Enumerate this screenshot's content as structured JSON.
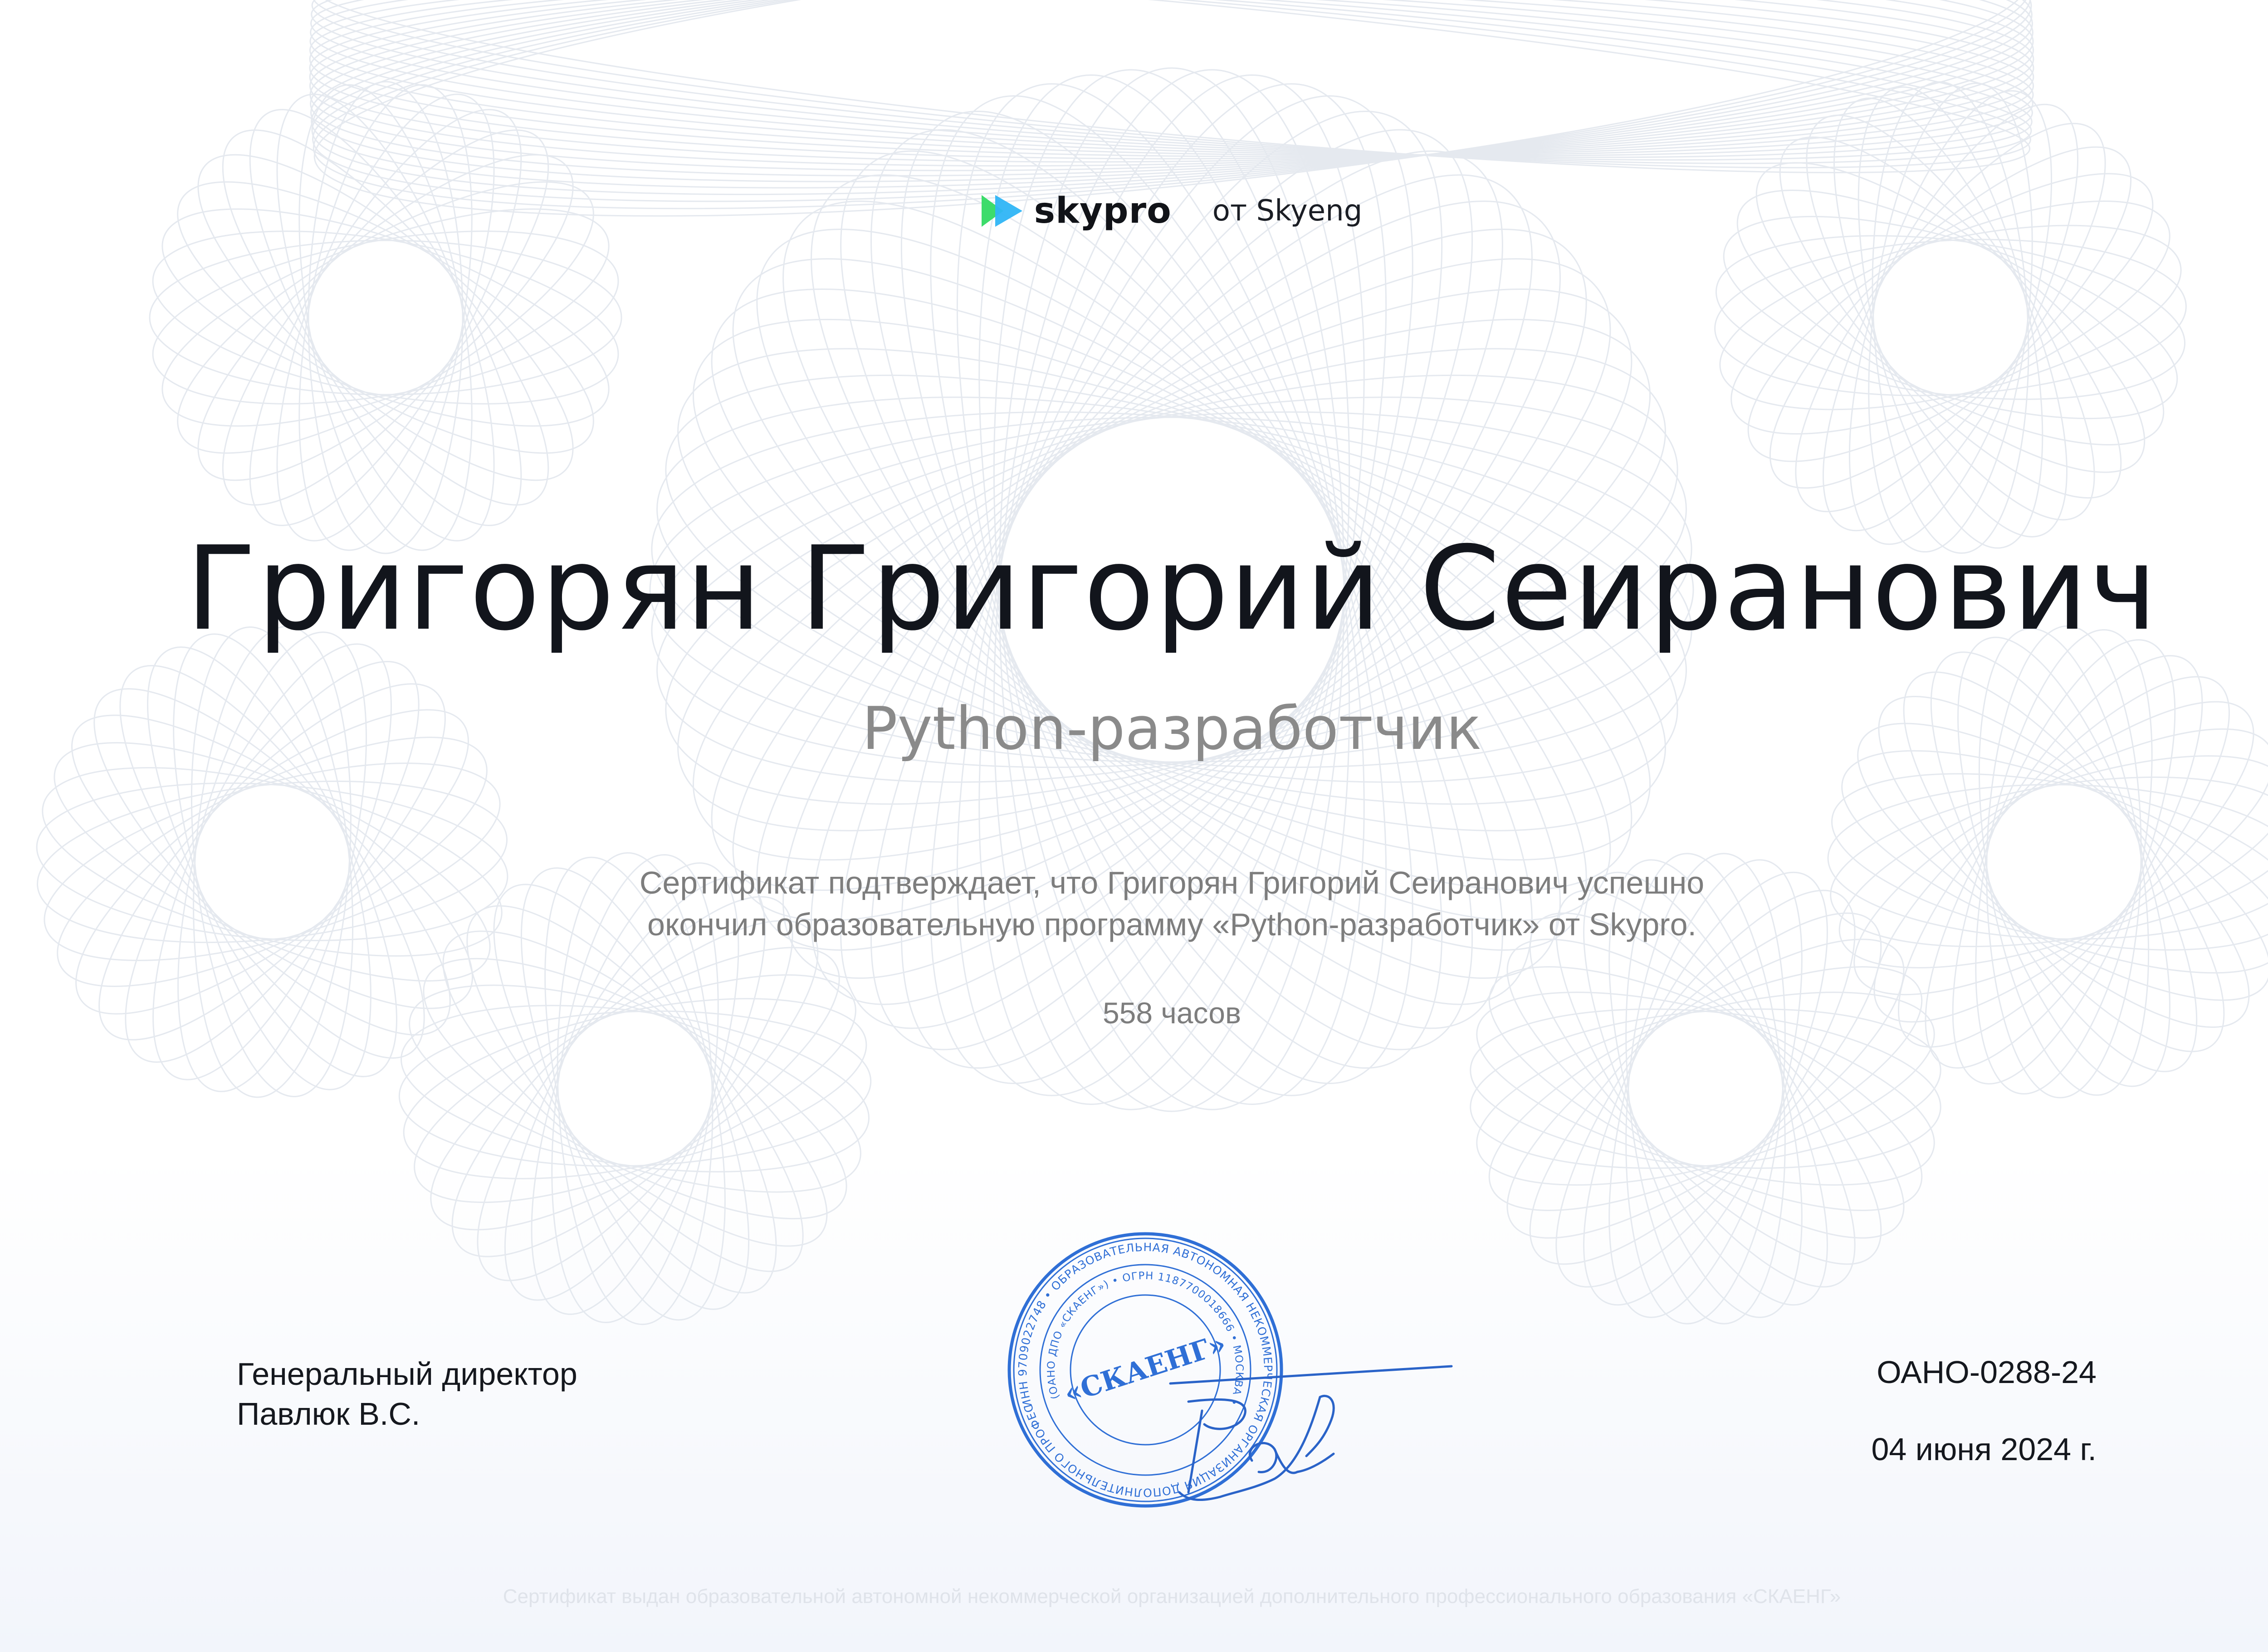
{
  "header": {
    "brand_name": "skypro",
    "brand_sub": "от Skyeng",
    "logo_icon": "skypro-play-icon"
  },
  "certificate": {
    "full_name": "Григорян Григорий Сеиранович",
    "program": "Python-разработчик",
    "statement_line1": "Сертификат подтверждает, что Григорян Григорий Сеиранович успешно",
    "statement_line2": "окончил образовательную программу «Python-разработчик» от Skypro.",
    "hours": "558 часов"
  },
  "signatory": {
    "title": "Генеральный директор",
    "name": "Павлюк В.С."
  },
  "meta": {
    "number": "ОАНО-0288-24",
    "date": "04 июня 2024 г."
  },
  "stamp": {
    "center_text": "«СКАЕНГ»",
    "outer_text": "ИНН 9709022748 • ОБРАЗОВАТЕЛЬНАЯ АВТОНОМНАЯ НЕКОММЕРЧЕСКАЯ ОРГАНИЗАЦИЯ ДОПОЛНИТЕЛЬНОГО ПРОФЕССИОНАЛЬНОГО ОБРАЗОВАНИЯ • ИНН 9709022748 •",
    "inner_text": "(ОАНО ДПО «СКАЕНГ») • ОГРН 1187700018666 • МОСКВА •",
    "color": "#2f6fd6"
  },
  "footer": {
    "text": "Сертификат выдан образовательной автономной некоммерческой организацией дополнительного профессионального образования «СКАЕНГ»"
  },
  "colors": {
    "logo_green": "#3ddc6b",
    "logo_blue": "#2fb5f5",
    "guilloche": "#dfe4ec"
  }
}
